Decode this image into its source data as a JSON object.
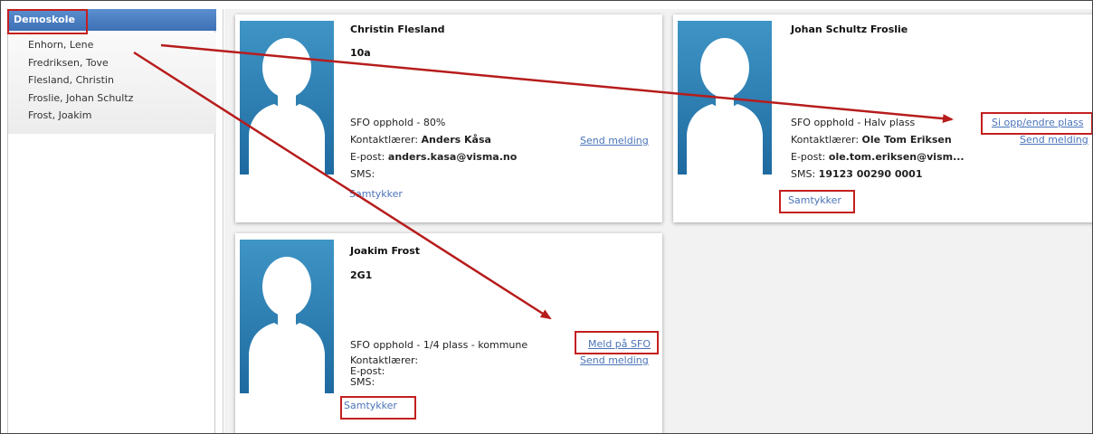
{
  "sidebar": {
    "school": "Demoskole",
    "students": [
      "Enhorn, Lene",
      "Fredriksen, Tove",
      "Flesland, Christin",
      "Froslie, Johan Schultz",
      "Frost, Joakim"
    ]
  },
  "cards": [
    {
      "name": "Christin Flesland",
      "class": "10a",
      "sfo": "SFO opphold - 80%",
      "teacher_label": "Kontaktlærer:",
      "teacher": "Anders Kåsa",
      "email_label": "E-post:",
      "email": "anders.kasa@visma.no",
      "sms_label": "SMS:",
      "sms": "",
      "send_message": "Send melding",
      "consent": "Samtykker"
    },
    {
      "name": "Johan Schultz Froslie",
      "class": "",
      "sfo": "SFO opphold - Halv plass",
      "sfo_action": "Si opp/endre plass",
      "teacher_label": "Kontaktlærer:",
      "teacher": "Ole Tom Eriksen",
      "email_label": "E-post:",
      "email": "ole.tom.eriksen@vism...",
      "sms_label": "SMS:",
      "sms": "19123 00290 0001",
      "send_message": "Send melding",
      "consent": "Samtykker"
    },
    {
      "name": "Joakim Frost",
      "class": "2G1",
      "sfo": "SFO opphold - 1/4 plass - kommune",
      "sfo_action": "Meld på SFO",
      "teacher_label": "Kontaktlærer:",
      "teacher": "",
      "email_label": "E-post:",
      "email": "",
      "sms_label": "SMS:",
      "sms": "",
      "send_message": "Send melding",
      "consent": "Samtykker"
    }
  ],
  "colors": {
    "header": "#3d6fb4",
    "link": "#4a74b8",
    "highlight": "#c41f1f",
    "avatar": "#2a7fb5"
  }
}
